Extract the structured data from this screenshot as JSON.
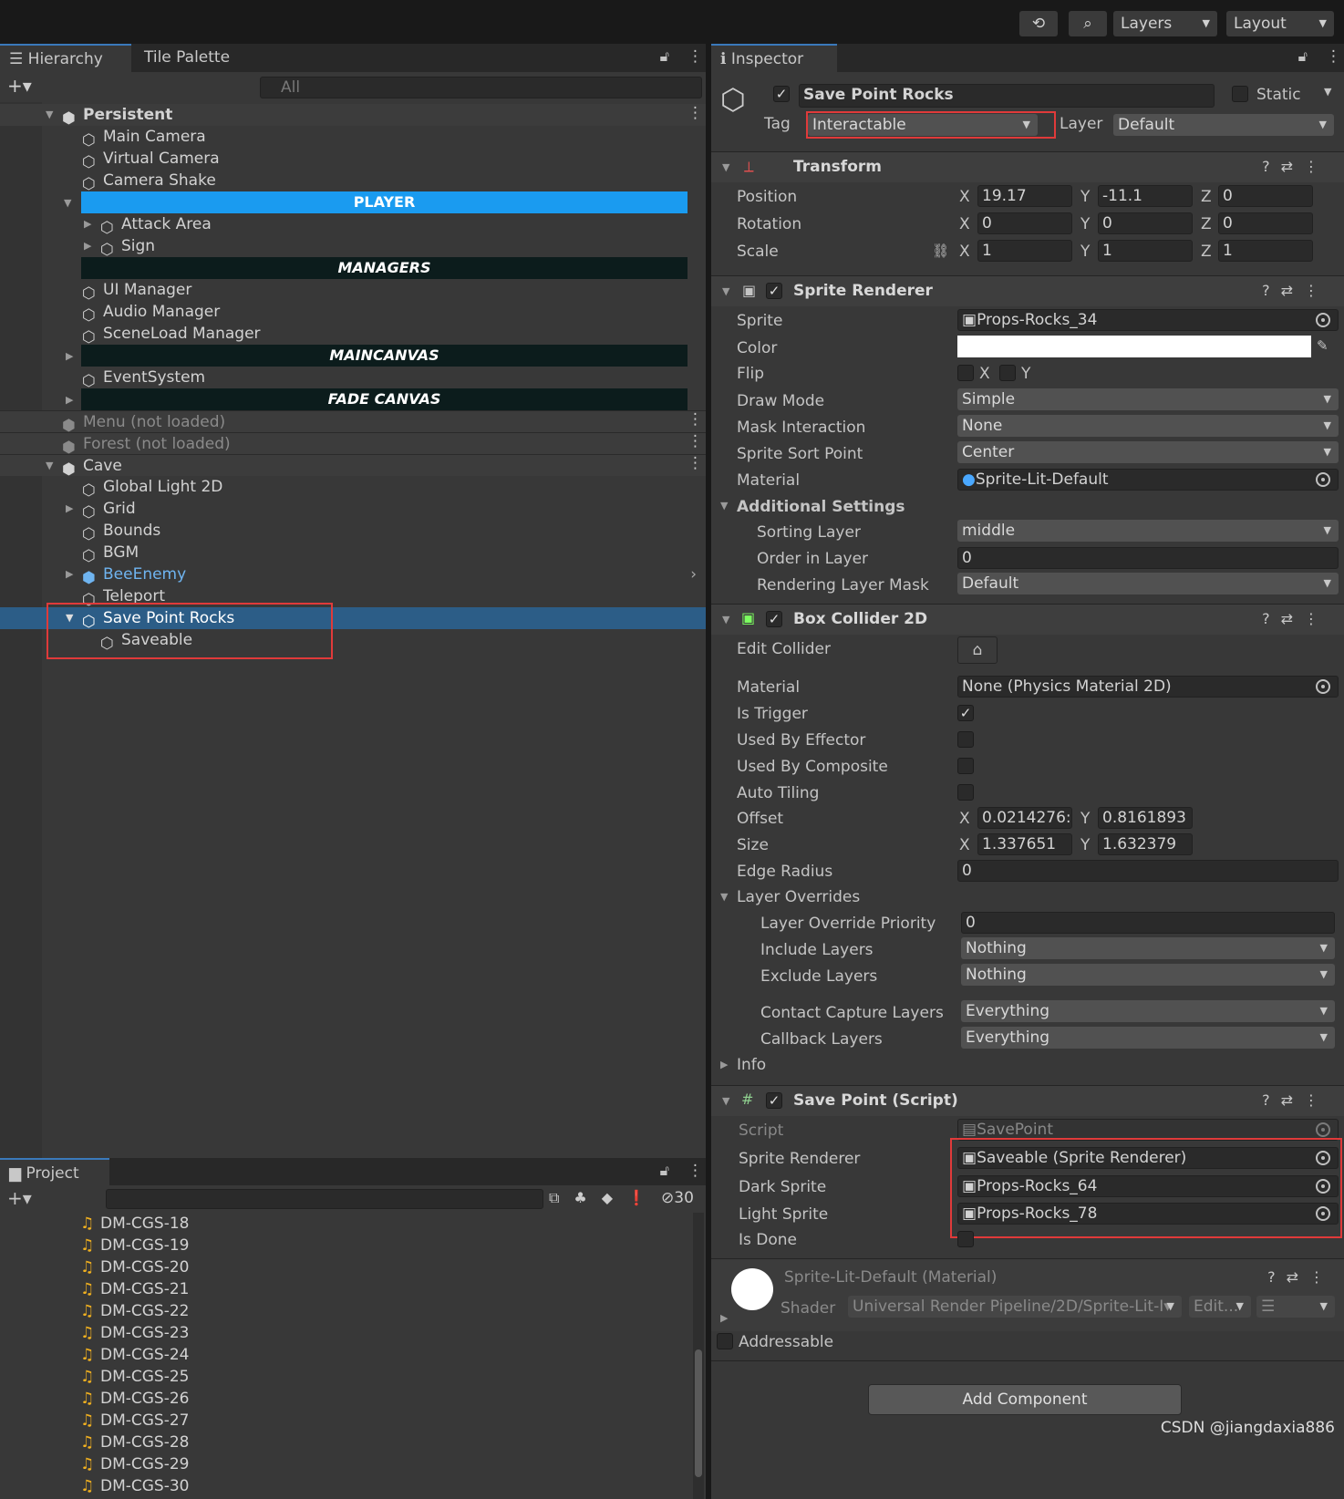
{
  "toolbar": {
    "layers_label": "Layers",
    "layout_label": "Layout"
  },
  "hierarchy": {
    "tab_label": "Hierarchy",
    "tab2_label": "Tile Palette",
    "search_placeholder": "All",
    "rows": [
      {
        "label": "Persistent"
      },
      {
        "label": "Main Camera"
      },
      {
        "label": "Virtual Camera"
      },
      {
        "label": "Camera Shake"
      },
      {
        "label": "PLAYER"
      },
      {
        "label": "Attack Area"
      },
      {
        "label": "Sign"
      },
      {
        "label": "MANAGERS"
      },
      {
        "label": "UI Manager"
      },
      {
        "label": "Audio Manager"
      },
      {
        "label": "SceneLoad Manager"
      },
      {
        "label": "MAINCANVAS"
      },
      {
        "label": "EventSystem"
      },
      {
        "label": "FADE CANVAS"
      },
      {
        "label": "Menu (not loaded)"
      },
      {
        "label": "Forest (not loaded)"
      },
      {
        "label": "Cave"
      },
      {
        "label": "Global Light 2D"
      },
      {
        "label": "Grid"
      },
      {
        "label": "Bounds"
      },
      {
        "label": "BGM"
      },
      {
        "label": "BeeEnemy"
      },
      {
        "label": "Teleport"
      },
      {
        "label": "Save Point Rocks"
      },
      {
        "label": "Saveable"
      }
    ]
  },
  "project": {
    "tab_label": "Project",
    "hidden_count": "30",
    "files": [
      "DM-CGS-18",
      "DM-CGS-19",
      "DM-CGS-20",
      "DM-CGS-21",
      "DM-CGS-22",
      "DM-CGS-23",
      "DM-CGS-24",
      "DM-CGS-25",
      "DM-CGS-26",
      "DM-CGS-27",
      "DM-CGS-28",
      "DM-CGS-29",
      "DM-CGS-30"
    ]
  },
  "inspector": {
    "tab_label": "Inspector",
    "object_name": "Save Point Rocks",
    "static_label": "Static",
    "tag_label": "Tag",
    "tag_value": "Interactable",
    "layer_label": "Layer",
    "layer_value": "Default",
    "transform": {
      "title": "Transform",
      "position_label": "Position",
      "rotation_label": "Rotation",
      "scale_label": "Scale",
      "pos": [
        "19.17",
        "-11.1",
        "0"
      ],
      "rot": [
        "0",
        "0",
        "0"
      ],
      "scale": [
        "1",
        "1",
        "1"
      ]
    },
    "sprite_renderer": {
      "title": "Sprite Renderer",
      "sprite_label": "Sprite",
      "sprite_value": "Props-Rocks_34",
      "color_label": "Color",
      "flip_label": "Flip",
      "draw_mode_label": "Draw Mode",
      "draw_mode_value": "Simple",
      "mask_label": "Mask Interaction",
      "mask_value": "None",
      "sort_point_label": "Sprite Sort Point",
      "sort_point_value": "Center",
      "material_label": "Material",
      "material_value": "Sprite-Lit-Default",
      "additional_label": "Additional Settings",
      "sorting_layer_label": "Sorting Layer",
      "sorting_layer_value": "middle",
      "order_label": "Order in Layer",
      "order_value": "0",
      "rlm_label": "Rendering Layer Mask",
      "rlm_value": "Default"
    },
    "box_collider": {
      "title": "Box Collider 2D",
      "edit_label": "Edit Collider",
      "material_label": "Material",
      "material_value": "None (Physics Material 2D)",
      "trigger_label": "Is Trigger",
      "effector_label": "Used By Effector",
      "composite_label": "Used By Composite",
      "tiling_label": "Auto Tiling",
      "offset_label": "Offset",
      "offset_x": "0.0214276:",
      "offset_y": "0.8161893",
      "size_label": "Size",
      "size_x": "1.337651",
      "size_y": "1.632379",
      "edge_label": "Edge Radius",
      "edge_value": "0",
      "overrides_label": "Layer Overrides",
      "priority_label": "Layer Override Priority",
      "priority_value": "0",
      "include_label": "Include Layers",
      "include_value": "Nothing",
      "exclude_label": "Exclude Layers",
      "exclude_value": "Nothing",
      "contact_label": "Contact Capture Layers",
      "contact_value": "Everything",
      "callback_label": "Callback Layers",
      "callback_value": "Everything",
      "info_label": "Info"
    },
    "save_point": {
      "title": "Save Point (Script)",
      "script_label": "Script",
      "script_value": "SavePoint",
      "sr_label": "Sprite Renderer",
      "sr_value": "Saveable (Sprite Renderer)",
      "dark_label": "Dark Sprite",
      "dark_value": "Props-Rocks_64",
      "light_label": "Light Sprite",
      "light_value": "Props-Rocks_78",
      "done_label": "Is Done"
    },
    "material": {
      "title": "Sprite-Lit-Default (Material)",
      "shader_label": "Shader",
      "shader_value": "Universal Render Pipeline/2D/Sprite-Lit-I▾",
      "edit_label": "Edit..."
    },
    "addressable_label": "Addressable",
    "add_component_label": "Add Component"
  },
  "watermark": "CSDN @jiangdaxia886",
  "colors": {
    "selection": "#2c5d87",
    "player_header": "#1a9bf0",
    "header_bg": "#0c1c1c",
    "highlight": "#e03a3a",
    "prefab": "#6fb4f0"
  }
}
